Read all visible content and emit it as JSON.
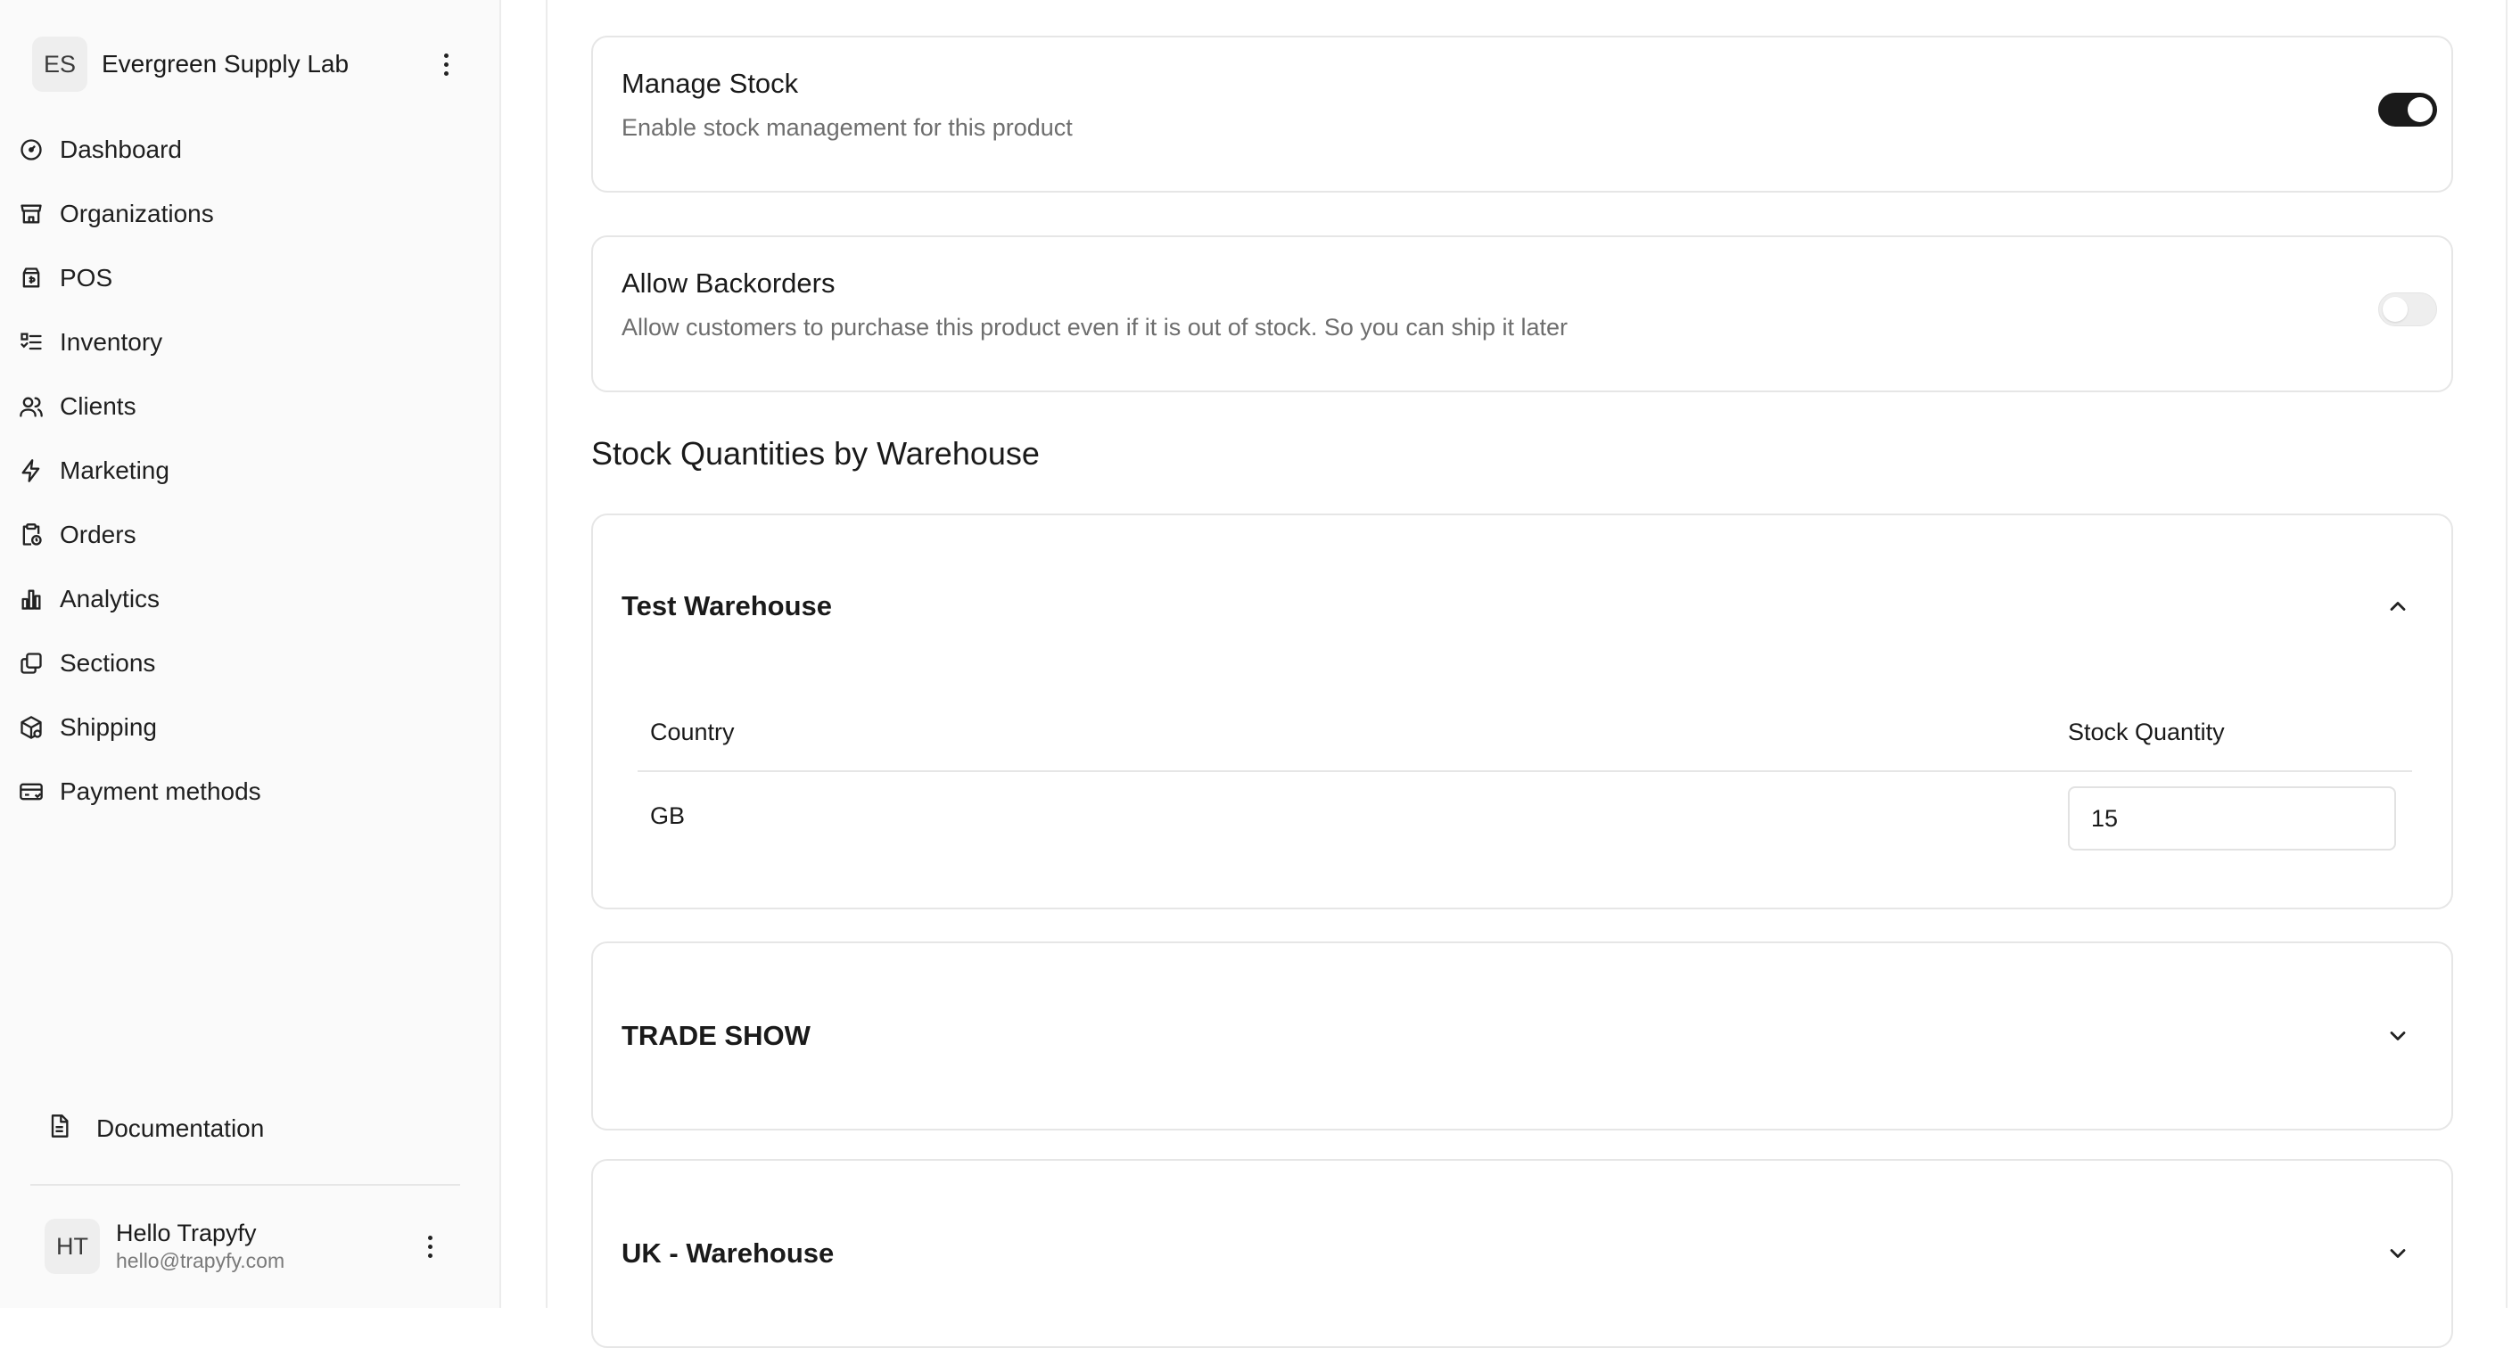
{
  "sidebar": {
    "org": {
      "initials": "ES",
      "name": "Evergreen Supply Lab"
    },
    "items": [
      {
        "label": "Dashboard",
        "icon": "dashboard-icon"
      },
      {
        "label": "Organizations",
        "icon": "store-icon"
      },
      {
        "label": "POS",
        "icon": "pos-bag-icon"
      },
      {
        "label": "Inventory",
        "icon": "inventory-list-icon"
      },
      {
        "label": "Clients",
        "icon": "users-icon"
      },
      {
        "label": "Marketing",
        "icon": "lightning-icon"
      },
      {
        "label": "Orders",
        "icon": "clipboard-icon"
      },
      {
        "label": "Analytics",
        "icon": "bar-chart-icon"
      },
      {
        "label": "Sections",
        "icon": "copy-icon"
      },
      {
        "label": "Shipping",
        "icon": "package-icon"
      },
      {
        "label": "Payment methods",
        "icon": "credit-card-icon"
      }
    ],
    "documentation": "Documentation",
    "user": {
      "initials": "HT",
      "name": "Hello Trapyfy",
      "email": "hello@trapyfy.com"
    }
  },
  "main": {
    "manage_stock": {
      "title": "Manage Stock",
      "description": "Enable stock management for this product",
      "enabled": true
    },
    "allow_backorders": {
      "title": "Allow Backorders",
      "description": "Allow customers to purchase this product even if it is out of stock. So you can ship it later",
      "enabled": false
    },
    "stock_section_title": "Stock Quantities by Warehouse",
    "warehouses": [
      {
        "name": "Test Warehouse",
        "expanded": true,
        "columns": {
          "country": "Country",
          "quantity": "Stock Quantity"
        },
        "rows": [
          {
            "country": "GB",
            "quantity": "15"
          }
        ]
      },
      {
        "name": "TRADE SHOW",
        "expanded": false
      },
      {
        "name": "UK - Warehouse",
        "expanded": false
      }
    ]
  },
  "colors": {
    "toggle_on": "#1a1a1a",
    "toggle_off": "#eeeeee",
    "border": "#e6e6e6",
    "muted_text": "#6e6e6e"
  }
}
